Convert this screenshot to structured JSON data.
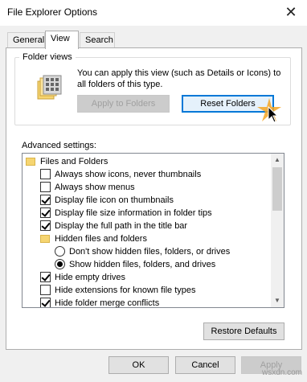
{
  "window": {
    "title": "File Explorer Options",
    "close_glyph": "✕"
  },
  "tabs": [
    {
      "label": "General",
      "active": false
    },
    {
      "label": "View",
      "active": true
    },
    {
      "label": "Search",
      "active": false
    }
  ],
  "folder_views": {
    "group_label": "Folder views",
    "description": "You can apply this view (such as Details or Icons) to all folders of this type.",
    "apply_button": "Apply to Folders",
    "reset_button": "Reset Folders"
  },
  "advanced": {
    "label": "Advanced settings:",
    "items": [
      {
        "type": "folder",
        "label": "Files and Folders",
        "level": 0
      },
      {
        "type": "checkbox",
        "label": "Always show icons, never thumbnails",
        "checked": false,
        "level": 1
      },
      {
        "type": "checkbox",
        "label": "Always show menus",
        "checked": false,
        "level": 1
      },
      {
        "type": "checkbox",
        "label": "Display file icon on thumbnails",
        "checked": true,
        "level": 1
      },
      {
        "type": "checkbox",
        "label": "Display file size information in folder tips",
        "checked": true,
        "level": 1
      },
      {
        "type": "checkbox",
        "label": "Display the full path in the title bar",
        "checked": true,
        "level": 1
      },
      {
        "type": "folder",
        "label": "Hidden files and folders",
        "level": 1
      },
      {
        "type": "radio",
        "label": "Don't show hidden files, folders, or drives",
        "selected": false,
        "level": 2
      },
      {
        "type": "radio",
        "label": "Show hidden files, folders, and drives",
        "selected": true,
        "level": 2
      },
      {
        "type": "checkbox",
        "label": "Hide empty drives",
        "checked": true,
        "level": 1
      },
      {
        "type": "checkbox",
        "label": "Hide extensions for known file types",
        "checked": false,
        "level": 1
      },
      {
        "type": "checkbox",
        "label": "Hide folder merge conflicts",
        "checked": true,
        "level": 1
      }
    ]
  },
  "restore_button": "Restore Defaults",
  "footer": {
    "ok": "OK",
    "cancel": "Cancel",
    "apply": "Apply"
  },
  "watermark": "wsxdn.com",
  "colors": {
    "focus_blue": "#0078d7",
    "folder_yellow": "#f6d571",
    "highlight_star": "#f5a623"
  }
}
